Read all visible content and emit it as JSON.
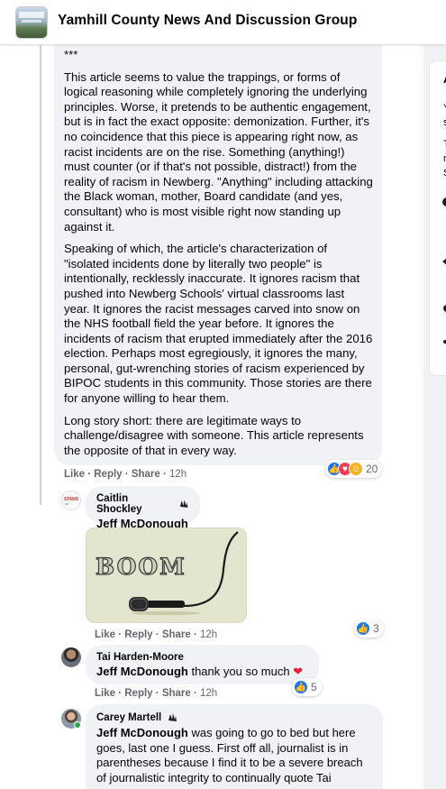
{
  "header": {
    "group_title": "Yamhill County News And Discussion Group"
  },
  "main_comment": {
    "stars": "***",
    "paragraphs": [
      "This article seems to value the trappings, or forms of logical reasoning while completely ignoring the underlying principles. Worse, it pretends to be authentic engagement, but is in fact the exact opposite: demonization. Further, it's no coincidence that this piece is appearing right now, as racist incidents are on the rise. Something (anything!) must counter (or if that's not possible, distract!) from the reality of racism in Newberg. \"Anything\" including attacking the Black woman, mother, Board candidate (and yes, consultant) who is most visible right now standing up against it.",
      "Speaking of which, the article's characterization of \"isolated incidents done by literally two people\" is intentionally, recklessly inaccurate. It ignores racism that pushed into Newberg Schools' virtual classrooms last year. It ignores the racist messages carved into snow on the NHS football field the year before. It ignores the incidents of racism that erupted immediately after the 2016 election. Perhaps most egregiously, it ignores the many, personal, gut-wrenching stories of racism experienced by BIPOC students in this community. Those stories are there for anyone willing to hear them.",
      "Long story short: there are legitimate ways to challenge/disagree with someone. This article represents the opposite of that in every way."
    ],
    "like_label": "Like",
    "reply_label": "Reply",
    "share_label": "Share",
    "time": "12h",
    "reaction_count": "20"
  },
  "replies": [
    {
      "author": "Caitlin Shockley",
      "mention": "Jeff McDonough",
      "text": "",
      "gif_text": "BOOM",
      "like_label": "Like",
      "reply_label": "Reply",
      "share_label": "Share",
      "time": "12h",
      "reaction_count": "3"
    },
    {
      "author": "Tai Harden-Moore",
      "mention": "Jeff McDonough",
      "text": "thank you so much",
      "like_label": "Like",
      "reply_label": "Reply",
      "share_label": "Share",
      "time": "12h",
      "reaction_count": "5"
    },
    {
      "author": "Carey Martell",
      "mention": "Jeff McDonough",
      "text": "was going to go to bed but here goes, last one I guess. First off all, journalist is in parentheses because I find it to be a severe breach of journalistic integrity to continually quote Tai"
    }
  ],
  "side_card": {
    "letters": [
      "A",
      "Y",
      "s",
      "T",
      "r",
      "S"
    ]
  },
  "colors": {
    "link_blue": "#1877f2",
    "meta_gray": "#65676b",
    "bubble_bg": "#f0f2f5",
    "heart_red": "#e41e3f"
  }
}
